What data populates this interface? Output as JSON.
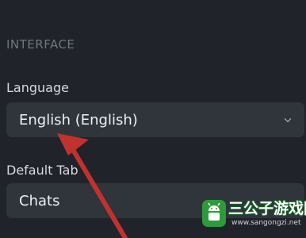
{
  "interface": {
    "section_title": "INTERFACE",
    "language": {
      "label": "Language",
      "value": "English (English)"
    },
    "default_tab": {
      "label": "Default Tab",
      "value": "Chats"
    }
  },
  "watermark": {
    "title": "三公子游戏网",
    "url": "www.sangongzi.net"
  },
  "colors": {
    "background": "#202329",
    "field": "#30343b",
    "arrow": "#c1322e",
    "watermark_green": "#2e9a3c"
  },
  "icons": {
    "dropdown": "chevron-down-icon",
    "annotation": "red-arrow",
    "logo": "android-robot-icon"
  }
}
